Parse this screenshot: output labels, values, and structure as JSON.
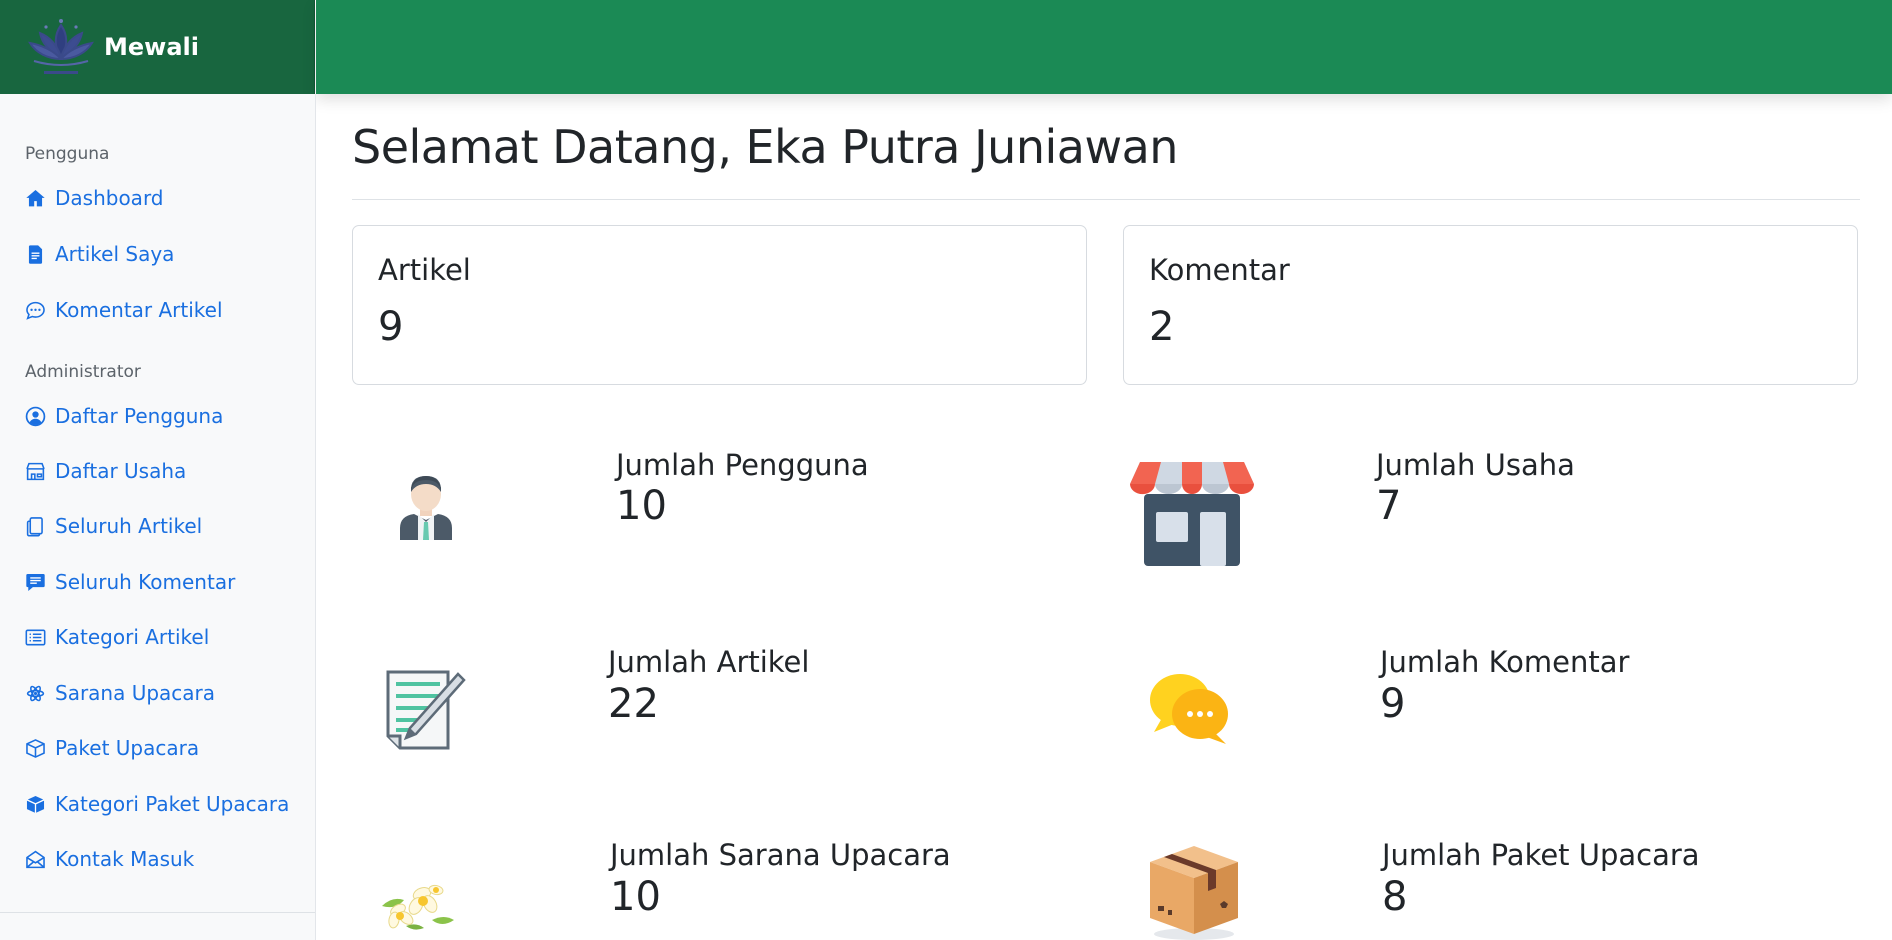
{
  "brand": {
    "name": "Mewali",
    "logo_icon": "lotus-logo-icon"
  },
  "sidebar": {
    "section_user": "Pengguna",
    "user_items": [
      {
        "label": "Dashboard",
        "icon": "house-icon"
      },
      {
        "label": "Artikel Saya",
        "icon": "file-text-icon"
      },
      {
        "label": "Komentar Artikel",
        "icon": "chat-dots-icon"
      }
    ],
    "section_admin": "Administrator",
    "admin_items": [
      {
        "label": "Daftar Pengguna",
        "icon": "person-circle-icon"
      },
      {
        "label": "Daftar Usaha",
        "icon": "shop-icon"
      },
      {
        "label": "Seluruh Artikel",
        "icon": "files-icon"
      },
      {
        "label": "Seluruh Komentar",
        "icon": "chat-left-text-icon"
      },
      {
        "label": "Kategori Artikel",
        "icon": "list-card-icon"
      },
      {
        "label": "Sarana Upacara",
        "icon": "flower-icon"
      },
      {
        "label": "Paket Upacara",
        "icon": "box-icon"
      },
      {
        "label": "Kategori Paket Upacara",
        "icon": "box-fill-icon"
      },
      {
        "label": "Kontak Masuk",
        "icon": "envelope-open-icon"
      }
    ]
  },
  "main": {
    "title": "Selamat Datang, Eka Putra Juniawan",
    "cards": [
      {
        "label": "Artikel",
        "value": "9"
      },
      {
        "label": "Komentar",
        "value": "2"
      }
    ],
    "tiles": [
      {
        "label": "Jumlah Pengguna",
        "value": "10",
        "icon": "user-avatar-icon"
      },
      {
        "label": "Jumlah Usaha",
        "value": "7",
        "icon": "storefront-icon"
      },
      {
        "label": "Jumlah Artikel",
        "value": "22",
        "icon": "document-pencil-icon"
      },
      {
        "label": "Jumlah Komentar",
        "value": "9",
        "icon": "chat-bubbles-icon"
      },
      {
        "label": "Jumlah Sarana Upacara",
        "value": "10",
        "icon": "frangipani-flowers-icon"
      },
      {
        "label": "Jumlah Paket Upacara",
        "value": "8",
        "icon": "cardboard-box-icon"
      }
    ]
  },
  "colors": {
    "brand_dark": "#18663f",
    "topbar": "#1b8a55",
    "link": "#1a6fe0"
  }
}
